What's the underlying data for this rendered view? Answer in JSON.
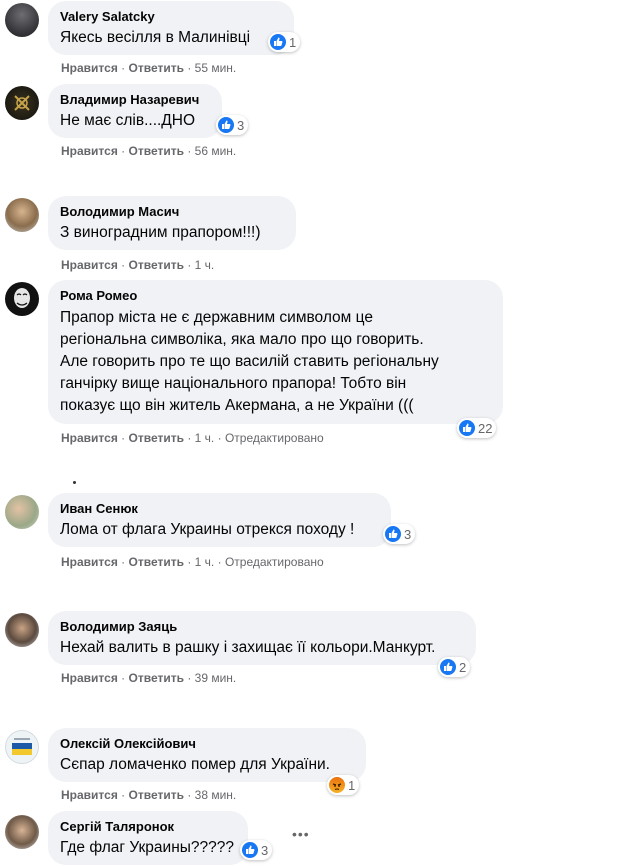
{
  "actions": {
    "like": "Нравится",
    "reply": "Ответить",
    "sep": "·"
  },
  "colors": {
    "like_blue": "#1877f2",
    "angry_orange": "#e9710f",
    "bubble": "#f0f2f5",
    "meta_gray": "#65676b"
  },
  "comments": [
    {
      "author": "Valery Salatcky",
      "text": [
        "Якесь весілля в Малинівці"
      ],
      "time": "55 мин.",
      "edited": "",
      "reaction_count": "1",
      "reaction_icon": "like-icon"
    },
    {
      "author": "Владимир Назаревич",
      "text": [
        "Не має слів....ДНО"
      ],
      "time": "56 мин.",
      "edited": "",
      "reaction_count": "3",
      "reaction_icon": "like-icon"
    },
    {
      "author": "Володимир Масич",
      "text": [
        "З виноградним прапором!!!)"
      ],
      "time": "1 ч.",
      "edited": "",
      "reaction_count": "",
      "reaction_icon": ""
    },
    {
      "author": "Рома Ромео",
      "text": [
        "Прапор міста не є державним символом це",
        "регіональна символіка, яка мало про що говорить.",
        "Але говорить про те що василій ставить регіональну",
        "ганчірку вище національного прапора! Тобто він",
        "показує що він житель Акермана, а не України ((("
      ],
      "time": "1 ч.",
      "edited": "Отредактировано",
      "reaction_count": "22",
      "reaction_icon": "like-icon"
    },
    {
      "author": "Иван Сенюк",
      "text": [
        "Ломa от флага Украины отрекся походу !"
      ],
      "time": "1 ч.",
      "edited": "Отредактировано",
      "reaction_count": "3",
      "reaction_icon": "like-icon"
    },
    {
      "author": "Володимир Заяць",
      "text": [
        "Нехай валить в рашку і захищає її кольори.Манкурт."
      ],
      "time": "39 мин.",
      "edited": "",
      "reaction_count": "2",
      "reaction_icon": "like-icon"
    },
    {
      "author": "Олексій Олексійович",
      "text": [
        "Сєпар ломаченко помер для України."
      ],
      "time": "38 мин.",
      "edited": "",
      "reaction_count": "1",
      "reaction_icon": "angry-icon"
    },
    {
      "author": "Сергій Таляронок",
      "text": [
        "Где флаг Украины?????"
      ],
      "time": "",
      "edited": "",
      "reaction_count": "3",
      "reaction_icon": "like-icon"
    }
  ],
  "more_icon": "more-options-icon",
  "more_glyph": "•••"
}
